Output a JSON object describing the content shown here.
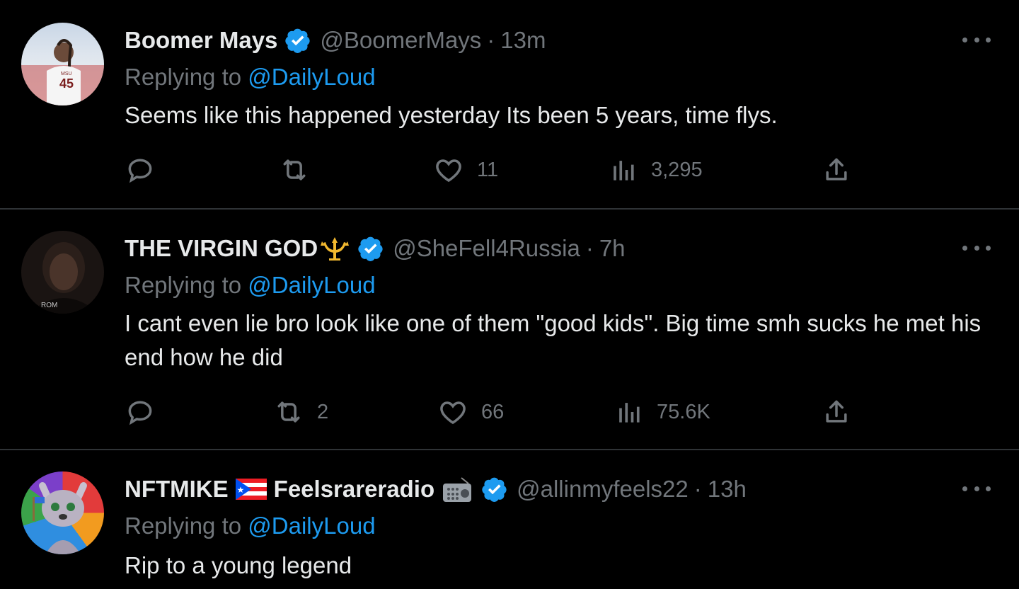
{
  "colors": {
    "background": "#000000",
    "text": "#e7e9ea",
    "secondary": "#71767b",
    "accent": "#1d9bf0",
    "divider": "#2f3336"
  },
  "tweets": [
    {
      "name": "Boomer Mays",
      "handle": "@BoomerMays",
      "separator": "·",
      "time": "13m",
      "replying_prefix": "Replying to",
      "replying_to": "@DailyLoud",
      "text": "Seems like this happened yesterday Its been 5 years, time flys.",
      "replies": "",
      "retweets": "",
      "likes": "11",
      "views": "3,295"
    },
    {
      "name": "THE VIRGIN GOD",
      "name_emoji_icon": "trident-icon",
      "handle": "@SheFell4Russia",
      "separator": "·",
      "time": "7h",
      "replying_prefix": "Replying to",
      "replying_to": "@DailyLoud",
      "text": "I cant even lie bro look like one of them \"good kids\". Big time smh sucks he met his end how he did",
      "replies": "",
      "retweets": "2",
      "likes": "66",
      "views": "75.6K"
    },
    {
      "name": "NFTMIKE",
      "name_flag_icon": "puerto-rico-flag-icon",
      "name_suffix": "Feelsrareradio",
      "name_emoji_icon": "radio-icon",
      "handle": "@allinmyfeels22",
      "separator": "·",
      "time": "13h",
      "replying_prefix": "Replying to",
      "replying_to": "@DailyLoud",
      "text": "Rip to a young legend"
    }
  ]
}
